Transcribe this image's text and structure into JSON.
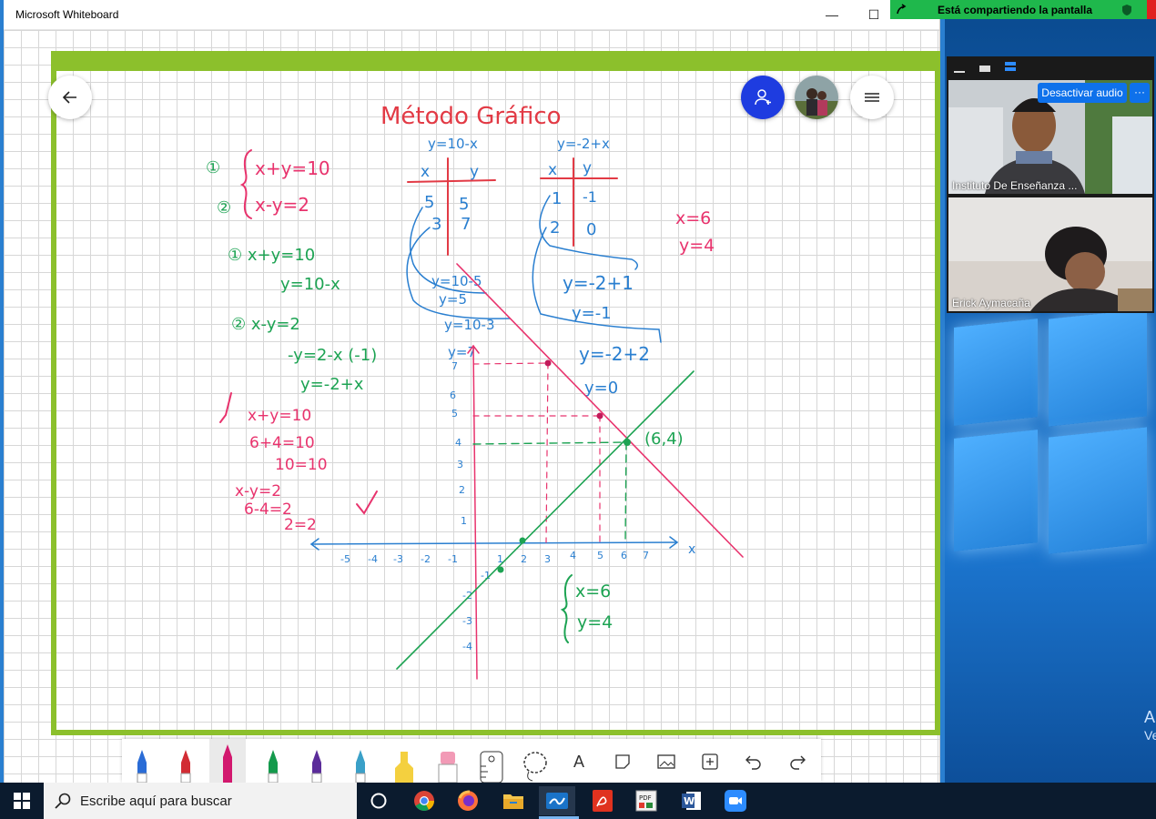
{
  "window": {
    "title": "Microsoft Whiteboard",
    "minimize": "—",
    "maximize": "☐"
  },
  "board": {
    "title": "Método Gráfico",
    "system": {
      "eq1_label": "①",
      "eq1": "x+y=10",
      "eq2_label": "②",
      "eq2": "x-y=2"
    },
    "derivations": [
      "① x+y=10",
      "y=10-x",
      "② x-y=2",
      "-y=2-x (-1)",
      "y=-2+x"
    ],
    "checks": [
      "x+y=10",
      "6+4=10",
      "10=10",
      "x-y=2",
      "6-4=2",
      "2=2"
    ],
    "table1": {
      "header": "y=10-x",
      "cols": [
        "x",
        "y"
      ],
      "rows": [
        [
          "5",
          "5"
        ],
        [
          "3",
          "7"
        ]
      ],
      "steps": [
        "y=10-5",
        "y=5",
        "y=10-3",
        "y=7"
      ]
    },
    "table2": {
      "header": "y=-2+x",
      "cols": [
        "x",
        "y"
      ],
      "rows": [
        [
          "1",
          "-1"
        ],
        [
          "2",
          "0"
        ]
      ],
      "steps": [
        "y=-2+1",
        "y=-1",
        "y=-2+2",
        "y=0"
      ]
    },
    "answer_top": {
      "x": "x=6",
      "y": "y=4"
    },
    "answer_bottom": {
      "x": "x=6",
      "y": "y=4"
    },
    "intersection": "(6,4)",
    "axis_x_label": "x",
    "x_ticks": [
      "-5",
      "-4",
      "-3",
      "-2",
      "-1",
      "1",
      "2",
      "3",
      "4",
      "5",
      "6",
      "7"
    ],
    "y_ticks": [
      "7",
      "6",
      "5",
      "4",
      "3",
      "2",
      "1",
      "-1",
      "-2",
      "-3",
      "-4"
    ]
  },
  "toolbar": {
    "tools": [
      "blue-pen",
      "red-pen",
      "magenta-pen",
      "green-pen",
      "purple-pen",
      "cyan-pen",
      "yellow-highlighter",
      "pink-highlighter",
      "ruler",
      "lasso",
      "text",
      "sticky-note",
      "image",
      "insert",
      "undo",
      "redo"
    ],
    "text_tool_label": "A",
    "insert_label": "+"
  },
  "zoom": {
    "share_text": "Está compartiendo la pantalla",
    "mute_label": "Desactivar audio",
    "more_label": "···",
    "participants": [
      {
        "name": "Instituto De Enseñanza ..."
      },
      {
        "name": "Erick Aymacaña"
      }
    ]
  },
  "taskbar": {
    "search_placeholder": "Escribe aquí para buscar",
    "apps": [
      "task-view",
      "chrome",
      "firefox",
      "file-explorer",
      "whiteboard",
      "acrobat",
      "pdf-app",
      "word",
      "zoom"
    ]
  },
  "desktop": {
    "text1": "A",
    "text2": "Ve"
  },
  "colors": {
    "frame": "#8cc02c",
    "ink_red": "#e8336d",
    "ink_green": "#1da353",
    "ink_blue": "#2a7fd0",
    "zoom_blue": "#0e71eb",
    "share_green": "#1fb84c"
  }
}
